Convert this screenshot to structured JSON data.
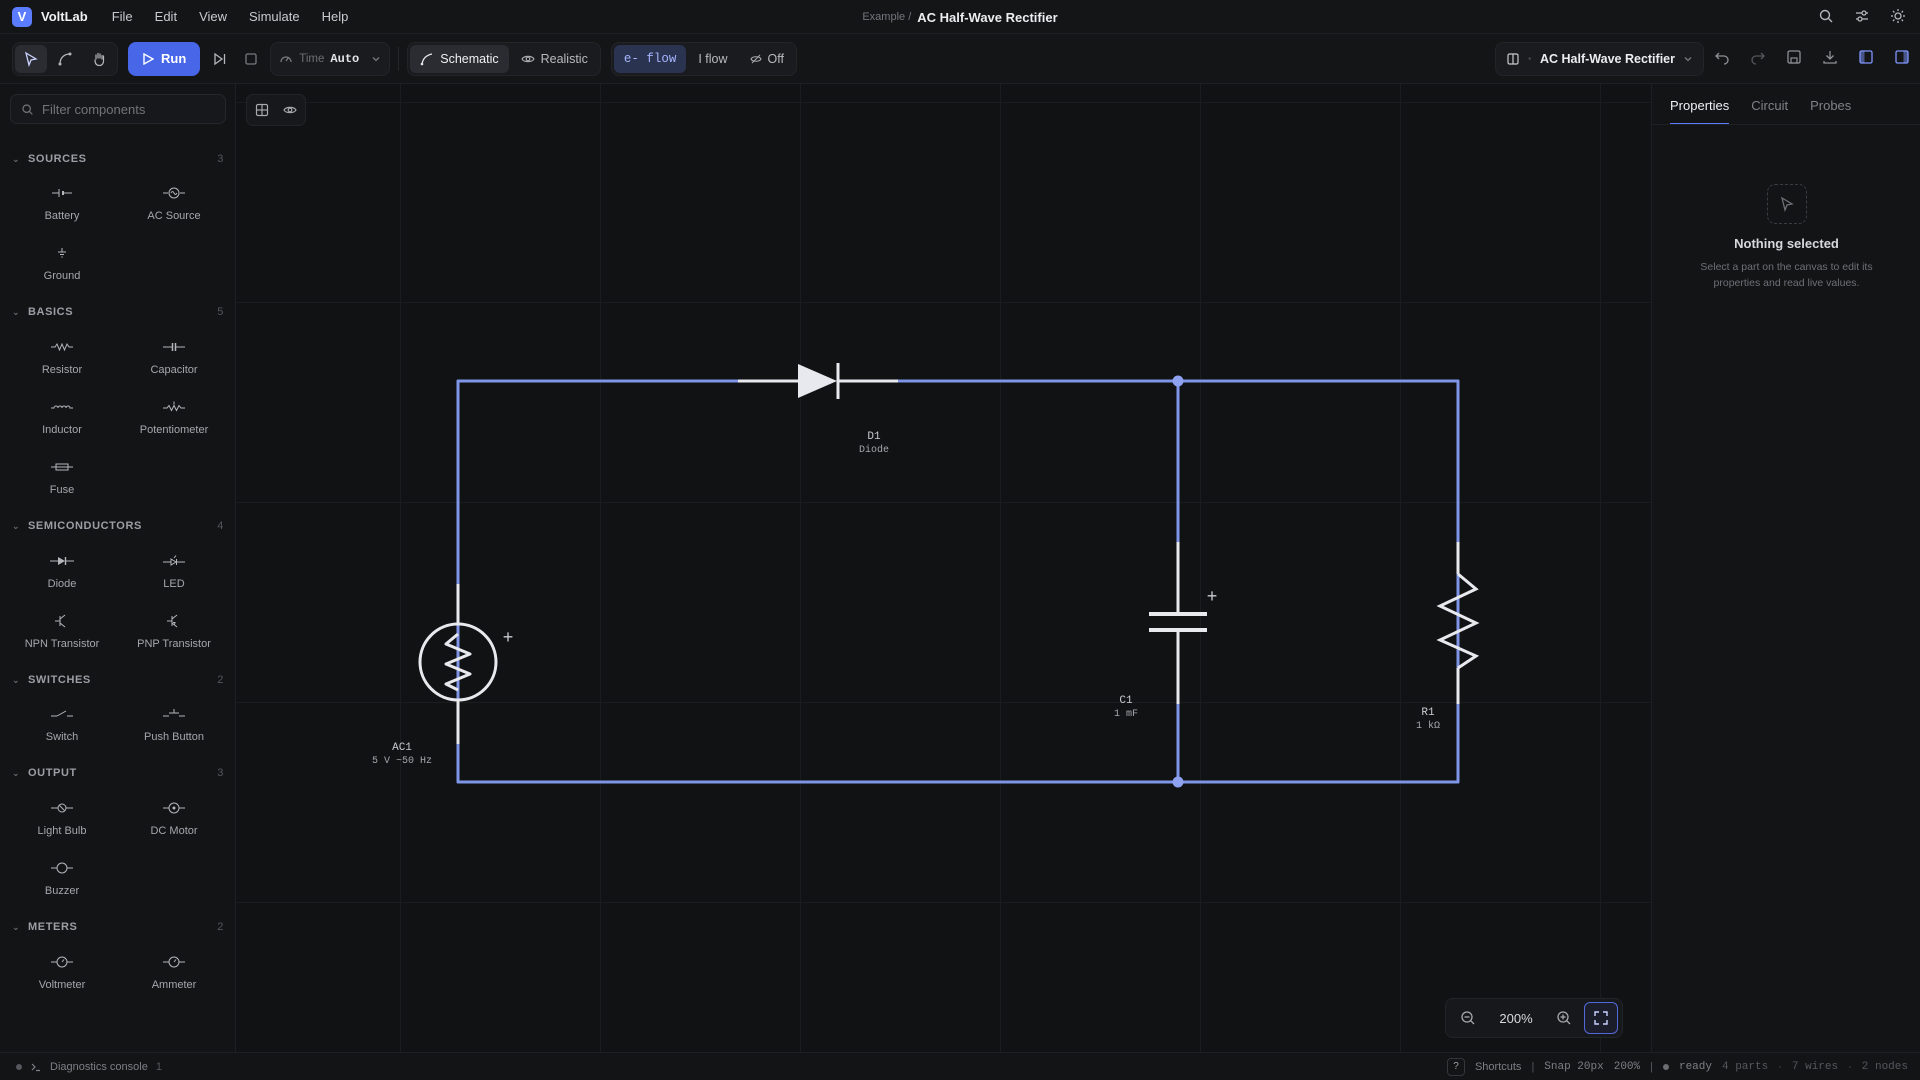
{
  "app": {
    "name": "VoltLab",
    "logo_letter": "V"
  },
  "menu": [
    "File",
    "Edit",
    "View",
    "Simulate",
    "Help"
  ],
  "document": {
    "breadcrumb": "Example /",
    "title": "AC Half-Wave Rectifier"
  },
  "toolbar": {
    "run_label": "Run",
    "time_label": "Time",
    "time_value": "Auto",
    "view_modes": [
      "Schematic",
      "Realistic"
    ],
    "active_view": "Schematic",
    "flow_modes": [
      "e- flow",
      "I flow",
      "Off"
    ],
    "active_flow": "e- flow",
    "circuit_name": "AC Half-Wave Rectifier"
  },
  "sidebar": {
    "filter_placeholder": "Filter components",
    "categories": [
      {
        "name": "SOURCES",
        "count": "3",
        "items": [
          "Battery",
          "AC Source",
          "Ground"
        ]
      },
      {
        "name": "BASICS",
        "count": "5",
        "items": [
          "Resistor",
          "Capacitor",
          "Inductor",
          "Potentiometer",
          "Fuse"
        ]
      },
      {
        "name": "SEMICONDUCTORS",
        "count": "4",
        "items": [
          "Diode",
          "LED",
          "NPN Transistor",
          "PNP Transistor"
        ]
      },
      {
        "name": "SWITCHES",
        "count": "2",
        "items": [
          "Switch",
          "Push Button"
        ]
      },
      {
        "name": "OUTPUT",
        "count": "3",
        "items": [
          "Light Bulb",
          "DC Motor",
          "Buzzer"
        ]
      },
      {
        "name": "METERS",
        "count": "2",
        "items": [
          "Voltmeter",
          "Ammeter"
        ]
      }
    ]
  },
  "circuit": {
    "parts": [
      {
        "id": "D1",
        "type": "Diode"
      },
      {
        "id": "C1",
        "value": "1 mF"
      },
      {
        "id": "R1",
        "value": "1 kΩ"
      },
      {
        "id": "AC1",
        "value": "5 V ~50 Hz"
      }
    ],
    "wire_color": "#7e95e8",
    "polarity_mark": "+"
  },
  "zoom": {
    "level": "200%"
  },
  "right_panel": {
    "tabs": [
      "Properties",
      "Circuit",
      "Probes"
    ],
    "active_tab": "Properties",
    "empty_title": "Nothing selected",
    "empty_desc": "Select a part on the canvas to edit its properties and read live values."
  },
  "statusbar": {
    "console_label": "Diagnostics console",
    "console_count": "1",
    "shortcuts_key": "?",
    "shortcuts_label": "Shortcuts",
    "snap": "Snap 20px",
    "zoom": "200%",
    "state": "ready",
    "parts": "4 parts",
    "wires": "7 wires",
    "nodes": "2 nodes",
    "sep": "·"
  },
  "colors": {
    "accent": "#4766e8",
    "wire": "#7e95e8",
    "node": "#8ea2f0",
    "ready": "#6b6d73"
  }
}
